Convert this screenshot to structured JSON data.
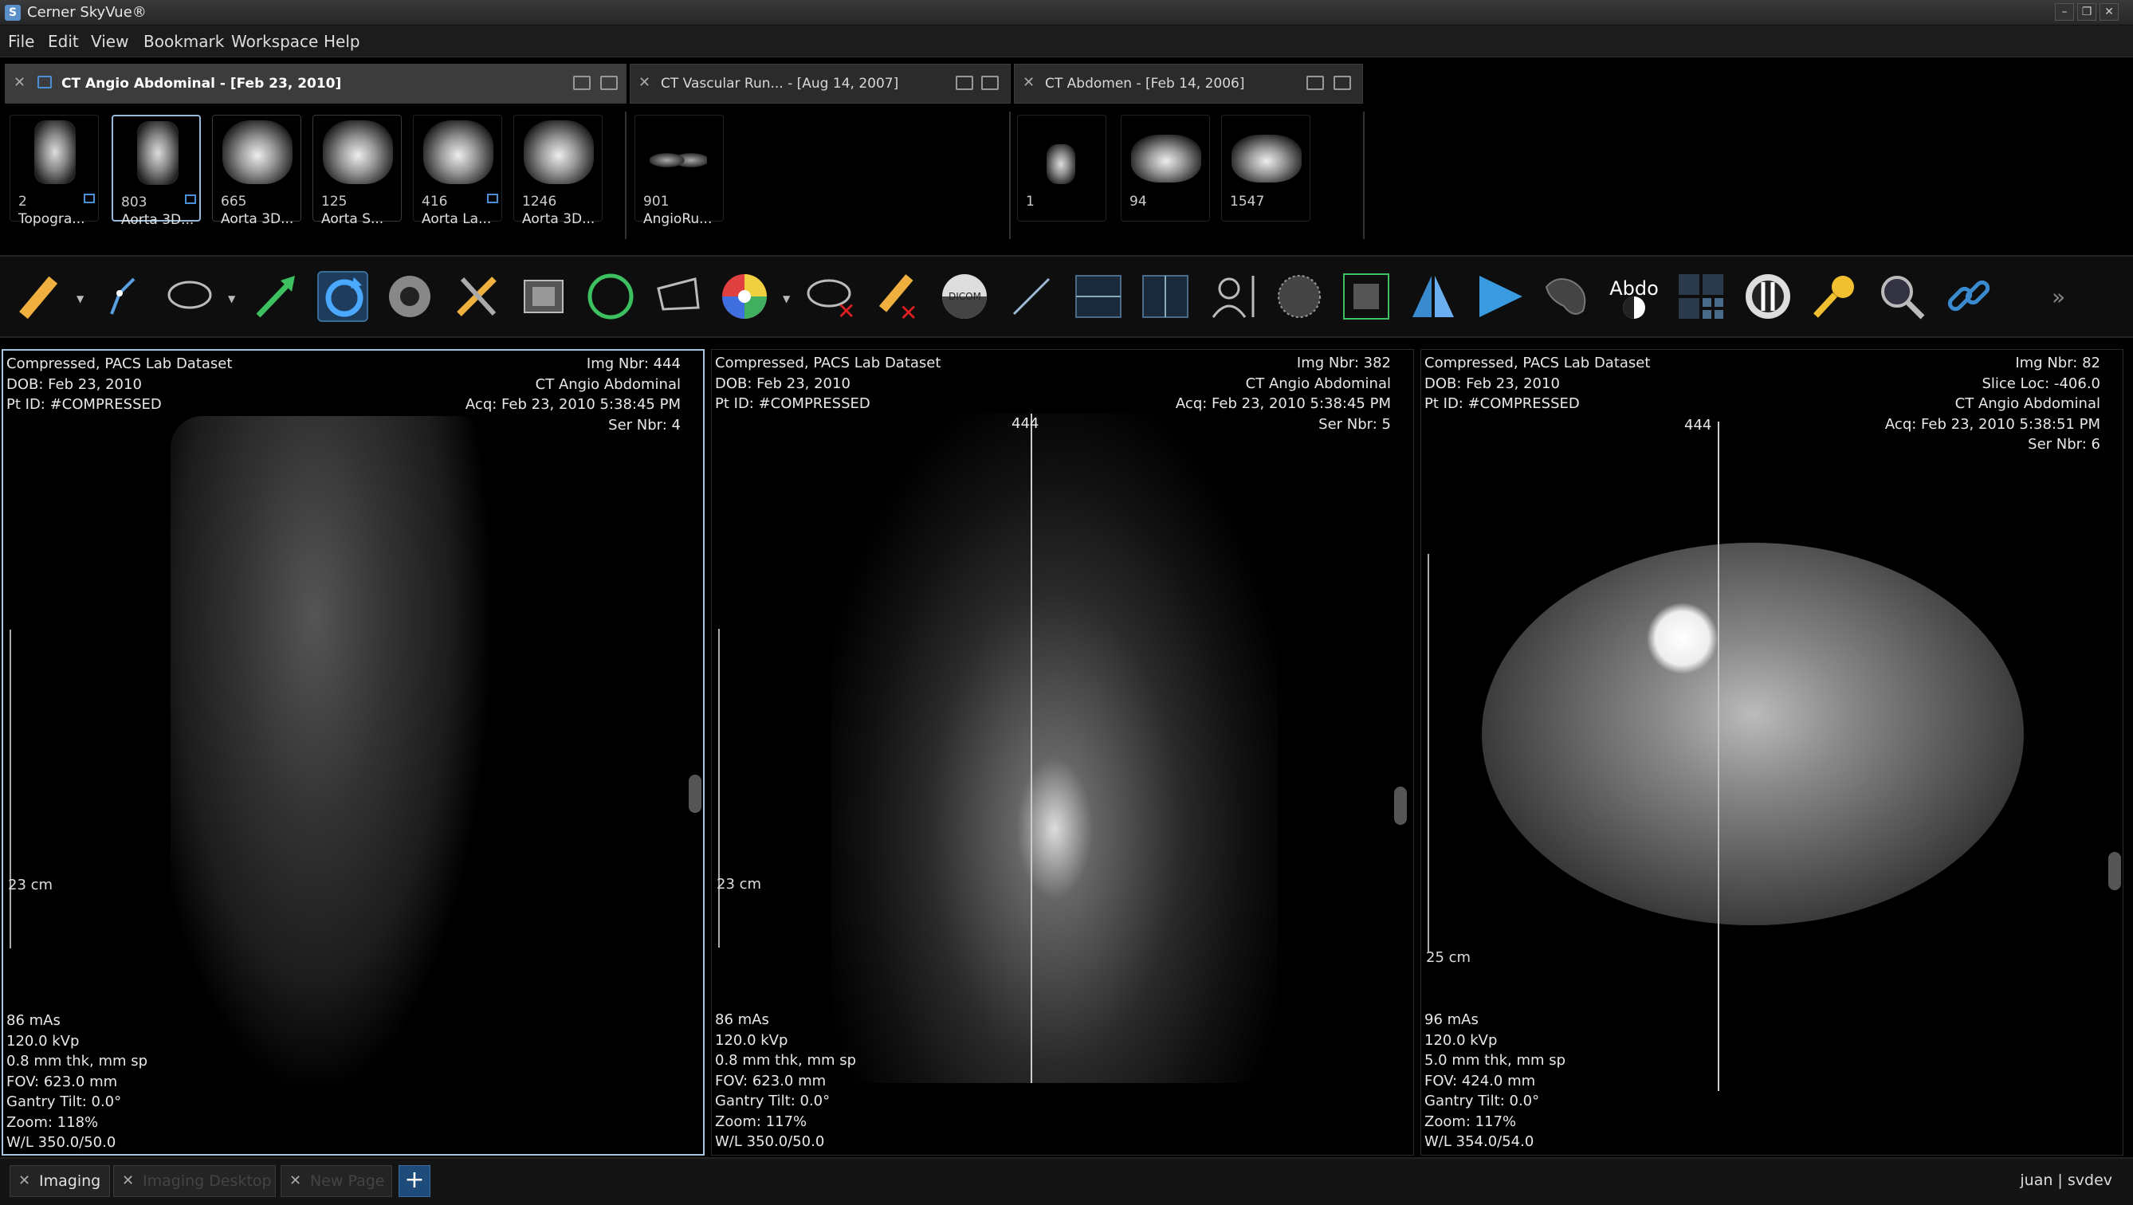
{
  "app": {
    "title": "Cerner SkyVue®"
  },
  "menu": [
    "File",
    "Edit",
    "View",
    "Bookmark",
    "Workspace",
    "Help"
  ],
  "studies": [
    {
      "label": "CT Angio Abdominal - [Feb 23, 2010]",
      "active": true
    },
    {
      "label": "CT Vascular Run... - [Aug 14, 2007]",
      "active": false
    },
    {
      "label": "CT Abdomen - [Feb 14, 2006]",
      "active": false
    }
  ],
  "thumbnails": {
    "group1": [
      {
        "num": "2",
        "label": "Topogra..."
      },
      {
        "num": "803",
        "label": "Aorta 3D..."
      },
      {
        "num": "665",
        "label": "Aorta 3D..."
      },
      {
        "num": "125",
        "label": "Aorta S..."
      },
      {
        "num": "416",
        "label": "Aorta La..."
      },
      {
        "num": "1246",
        "label": "Aorta 3D..."
      }
    ],
    "group2": [
      {
        "num": "901",
        "label": "AngioRu..."
      }
    ],
    "group3": [
      {
        "num": "1",
        "label": ""
      },
      {
        "num": "94",
        "label": ""
      },
      {
        "num": "1547",
        "label": ""
      }
    ]
  },
  "toolbar": {
    "tools": [
      "ruler-icon",
      "angle-icon",
      "ellipse-roi-icon",
      "arrow-annotation-icon",
      "rotate-icon",
      "gear-wheel-icon",
      "tools-icon",
      "cine-film-icon",
      "circle-roi-icon",
      "polygon-roi-icon",
      "color-wheel-icon",
      "delete-comment-icon",
      "delete-measurements-icon",
      "dicom-icon",
      "line-icon",
      "horizontal-split-icon",
      "vertical-split-icon",
      "patient-info-icon",
      "circle-icon",
      "fit-window-icon",
      "flip-icon",
      "play-icon",
      "freehand-roi-icon",
      "abdo-preset-icon",
      "layout-grid-icon",
      "sync-icon",
      "key-image-icon",
      "magnify-icon",
      "link-icon",
      "more-icon"
    ],
    "preset_label": "Abdo"
  },
  "viewports": [
    {
      "tl": [
        "Compressed, PACS Lab Dataset",
        "DOB: Feb 23, 2010",
        "Pt ID: #COMPRESSED"
      ],
      "tr": [
        "Img Nbr: 444",
        "CT Angio Abdominal",
        "Acq: Feb 23, 2010 5:38:45 PM",
        "Ser Nbr: 4"
      ],
      "bl": [
        "86 mAs",
        "120.0 kVp",
        "0.8 mm thk, mm sp",
        "FOV: 623.0 mm",
        "Gantry Tilt: 0.0°",
        "Zoom: 118%",
        "W/L 350.0/50.0"
      ],
      "scale": "23 cm"
    },
    {
      "tl": [
        "Compressed, PACS Lab Dataset",
        "DOB: Feb 23, 2010",
        "Pt ID: #COMPRESSED"
      ],
      "tr": [
        "Img Nbr: 382",
        "CT Angio Abdominal",
        "Acq: Feb 23, 2010 5:38:45 PM",
        "Ser Nbr: 5"
      ],
      "bl": [
        "86 mAs",
        "120.0 kVp",
        "0.8 mm thk, mm sp",
        "FOV: 623.0 mm",
        "Gantry Tilt: 0.0°",
        "Zoom: 117%",
        "W/L 350.0/50.0"
      ],
      "scale": "23 cm",
      "ref": "444"
    },
    {
      "tl": [
        "Compressed, PACS Lab Dataset",
        "DOB: Feb 23, 2010",
        "Pt ID: #COMPRESSED"
      ],
      "tr": [
        "Img Nbr: 82",
        "Slice Loc: -406.0",
        "CT Angio Abdominal",
        "Acq: Feb 23, 2010 5:38:51 PM",
        "Ser Nbr: 6"
      ],
      "bl": [
        "96 mAs",
        "120.0 kVp",
        "5.0 mm thk, mm sp",
        "FOV: 424.0 mm",
        "Gantry Tilt: 0.0°",
        "Zoom: 117%",
        "W/L 354.0/54.0"
      ],
      "scale": "25 cm",
      "ref": "444"
    }
  ],
  "bottom_tabs": [
    "Imaging",
    "Imaging Desktop",
    "New Page"
  ],
  "user": "juan  |  svdev",
  "colors": {
    "accent": "#3a6c98",
    "active_border": "#a7c4e0",
    "tab_link": "#4b8fd8"
  }
}
